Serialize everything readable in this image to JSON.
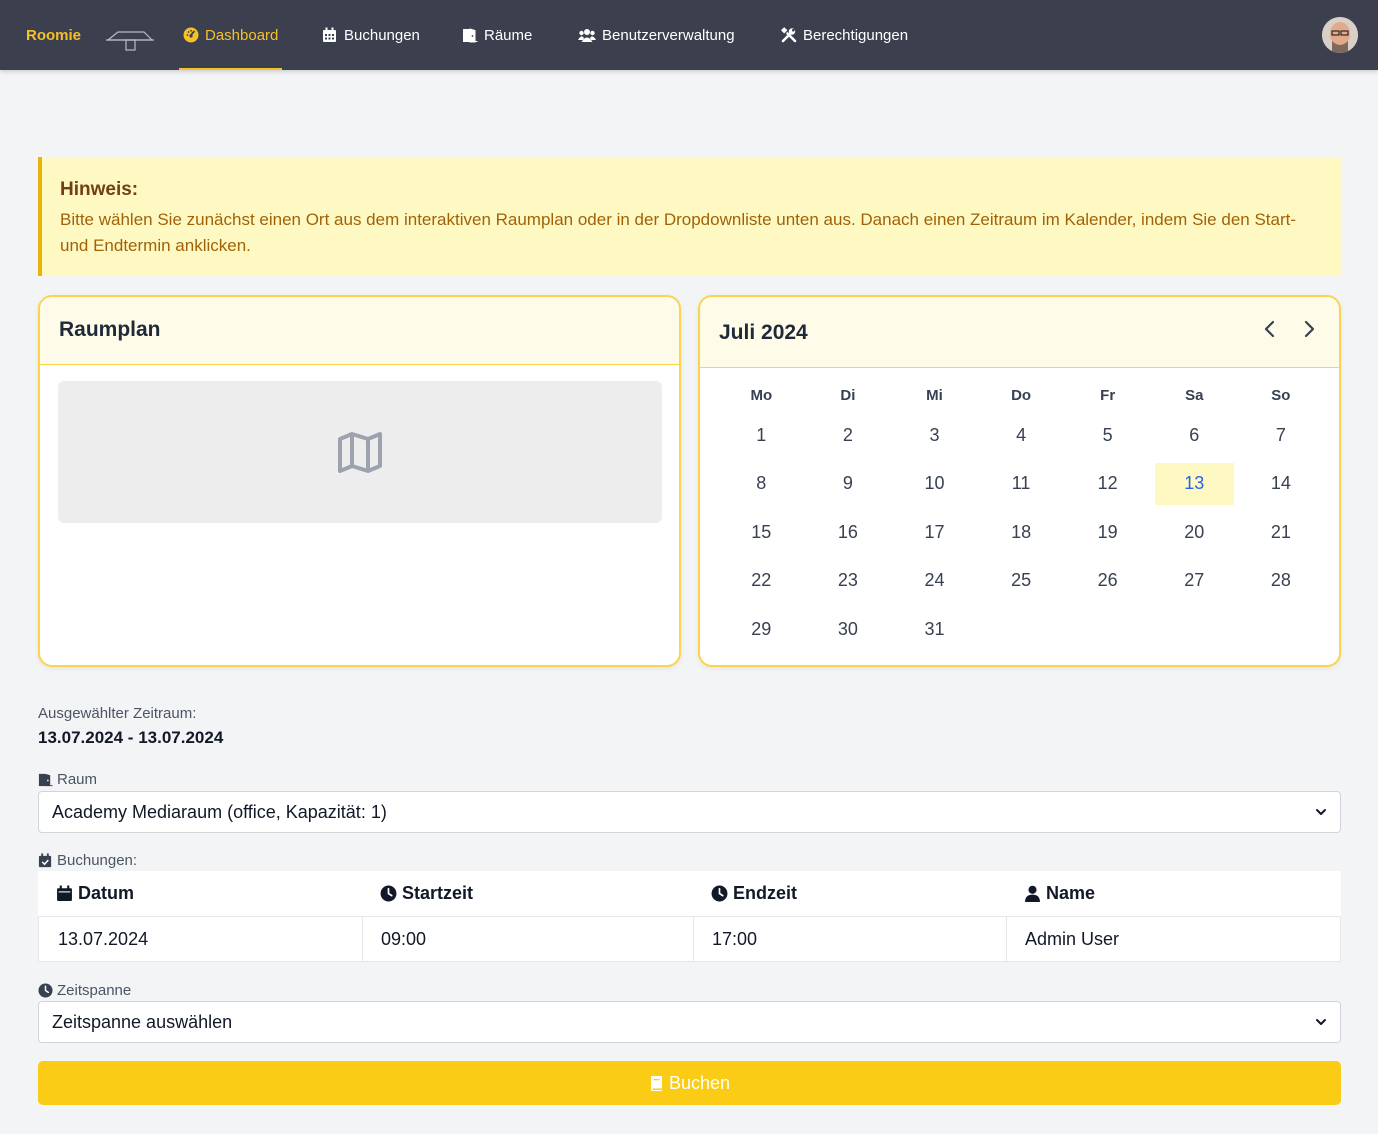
{
  "nav": {
    "brand": "Roomie",
    "items": [
      {
        "label": "Dashboard",
        "icon": "gauge-icon",
        "active": true
      },
      {
        "label": "Buchungen",
        "icon": "calendar-icon"
      },
      {
        "label": "Räume",
        "icon": "door-icon"
      },
      {
        "label": "Benutzerverwaltung",
        "icon": "users-icon"
      },
      {
        "label": "Berechtigungen",
        "icon": "tools-icon"
      }
    ]
  },
  "alert": {
    "title": "Hinweis:",
    "text": "Bitte wählen Sie zunächst einen Ort aus dem interaktiven Raumplan oder in der Dropdownliste unten aus. Danach einen Zeitraum im Kalender, indem Sie den Start- und Endtermin anklicken."
  },
  "raumplan": {
    "title": "Raumplan"
  },
  "calendar": {
    "title": "Juli 2024",
    "weekdays": [
      "Mo",
      "Di",
      "Mi",
      "Do",
      "Fr",
      "Sa",
      "So"
    ],
    "weeks": [
      [
        "1",
        "2",
        "3",
        "4",
        "5",
        "6",
        "7"
      ],
      [
        "8",
        "9",
        "10",
        "11",
        "12",
        "13",
        "14"
      ],
      [
        "15",
        "16",
        "17",
        "18",
        "19",
        "20",
        "21"
      ],
      [
        "22",
        "23",
        "24",
        "25",
        "26",
        "27",
        "28"
      ],
      [
        "29",
        "30",
        "31",
        "",
        "",
        "",
        ""
      ]
    ],
    "selected_day": "13"
  },
  "selection": {
    "label": "Ausgewählter Zeitraum:",
    "value": "13.07.2024 - 13.07.2024"
  },
  "room": {
    "label": "Raum",
    "value": "Academy Mediaraum (office, Kapazität: 1)"
  },
  "bookings": {
    "label": "Buchungen:",
    "columns": [
      "Datum",
      "Startzeit",
      "Endzeit",
      "Name"
    ],
    "rows": [
      [
        "13.07.2024",
        "09:00",
        "17:00",
        "Admin User"
      ]
    ]
  },
  "timespan": {
    "label": "Zeitspanne",
    "value": "Zeitspanne auswählen"
  },
  "book_button": {
    "label": "Buchen"
  },
  "colors": {
    "accent": "#facc15",
    "nav_bg": "#3b3f4e",
    "brand": "#f6c026"
  }
}
